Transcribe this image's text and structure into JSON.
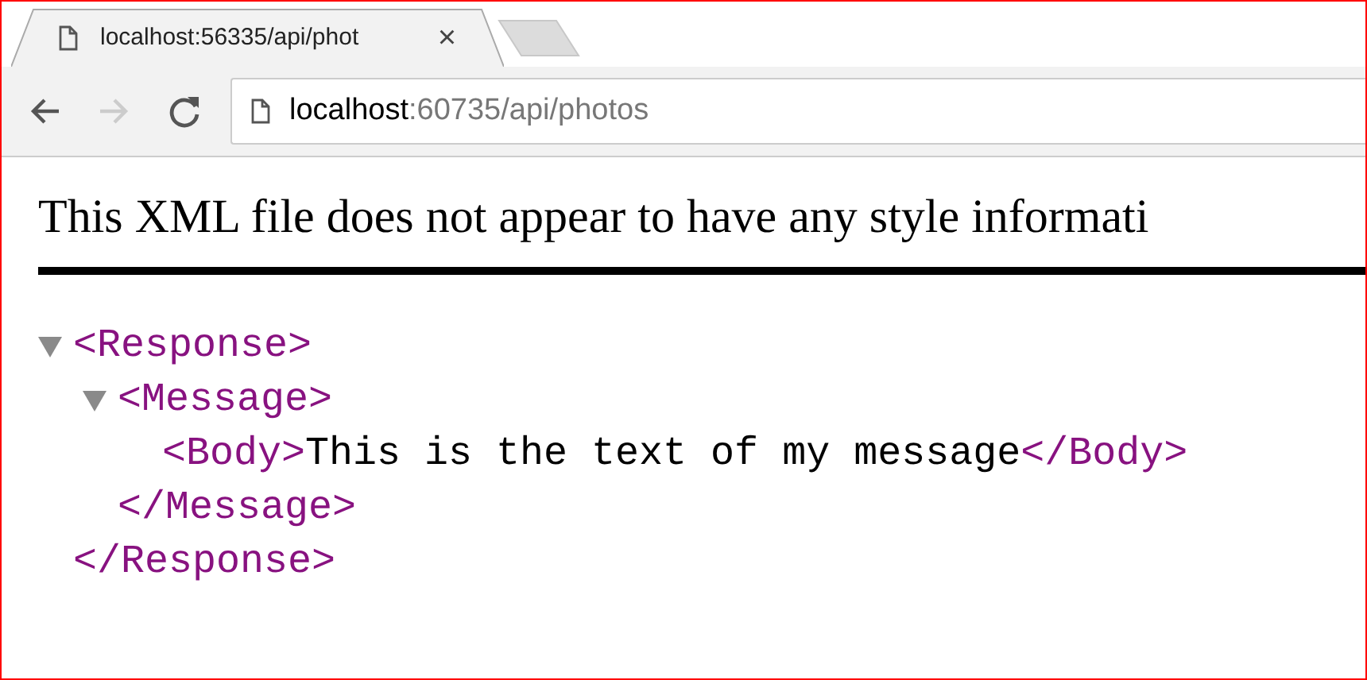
{
  "tab": {
    "title": "localhost:56335/api/phot",
    "close": "×"
  },
  "toolbar": {
    "back_disabled": false,
    "forward_disabled": true
  },
  "address": {
    "host": "localhost",
    "path": ":60735/api/photos"
  },
  "notice": "This XML file does not appear to have any style informati",
  "tree": [
    {
      "open": "<Response>",
      "close": "</Response>",
      "expanded": true,
      "children": [
        {
          "open": "<Message>",
          "close": "</Message>",
          "expanded": true,
          "children": [
            {
              "open": "<Body>",
              "text": "This is the text of my message",
              "close": "</Body>"
            }
          ]
        }
      ]
    }
  ]
}
